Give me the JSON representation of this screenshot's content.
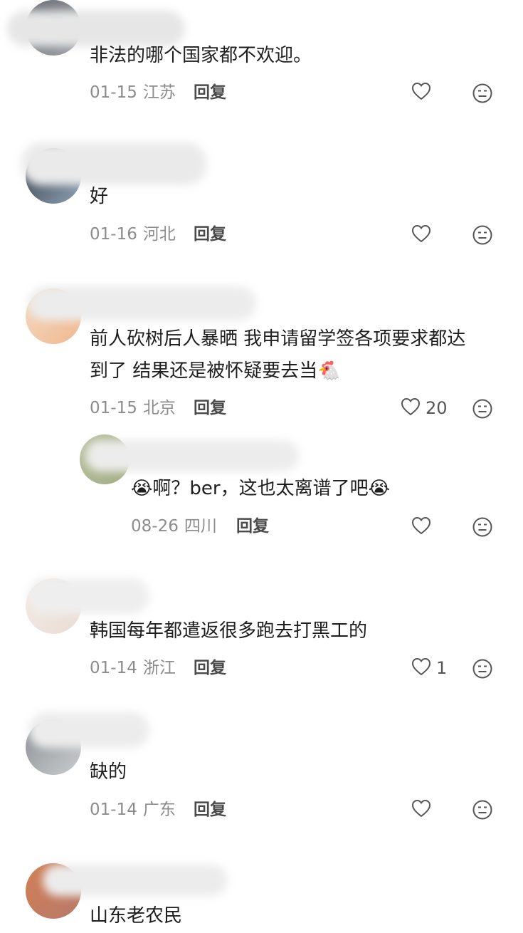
{
  "comments": [
    {
      "text": "非法的哪个国家都不欢迎。",
      "date": "01-15",
      "location": "江苏",
      "reply": "回复",
      "likes": ""
    },
    {
      "text": "好",
      "date": "01-16",
      "location": "河北",
      "reply": "回复",
      "likes": ""
    },
    {
      "text_line1": "前人砍树后人暴晒 我申请留学签各项要求都达",
      "text_line2": "到了 结果还是被怀疑要去当🐔",
      "date": "01-15",
      "location": "北京",
      "reply": "回复",
      "likes": "20"
    },
    {
      "text": "😭啊？ber，这也太离谱了吧😭",
      "date": "08-26",
      "location": "四川",
      "reply": "回复",
      "likes": ""
    },
    {
      "text": "韩国每年都遣返很多跑去打黑工的",
      "date": "01-14",
      "location": "浙江",
      "reply": "回复",
      "likes": "1"
    },
    {
      "text": "缺的",
      "date": "01-14",
      "location": "广东",
      "reply": "回复",
      "likes": ""
    },
    {
      "text": "山东老农民",
      "date": "",
      "location": "",
      "reply": "",
      "likes": ""
    }
  ],
  "colors": {
    "text": "#1e1e1e",
    "meta": "#8c8c8c",
    "icon": "#555555"
  }
}
